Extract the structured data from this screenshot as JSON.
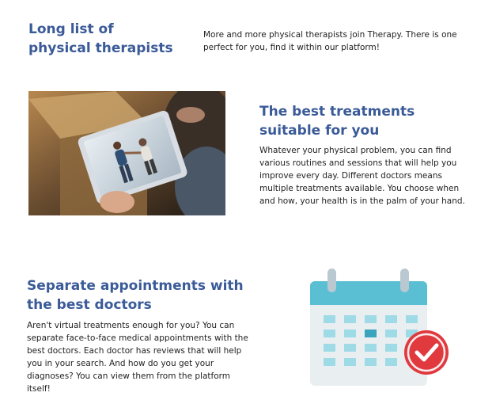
{
  "sections": [
    {
      "title_line1": "Long list of",
      "title_line2": "physical therapists",
      "text": "More and more physical therapists join Therapy. There is one perfect for you, find it within our platform!"
    },
    {
      "title": "The best treatments suitable for you",
      "text": "Whatever your physical problem, you can find various routines and sessions that will help you improve every day. Different doctors means multiple treatments available. You choose when and how, your health is in the palm of your hand.",
      "image": "tablet-video-therapy-photo"
    },
    {
      "title": "Separate appointments with the best doctors",
      "text": "Aren't virtual treatments enough for you? You can separate face-to-face medical appointments with the best doctors. Each doctor has reviews that will help you in your search. And how do you get your diagnoses? You can view them from the platform itself!",
      "icon": "calendar-check-icon"
    }
  ],
  "colors": {
    "heading": "#3a5a98",
    "calendar_header": "#5bbfd3",
    "calendar_cells": "#9fdbe6",
    "calendar_selected": "#3aa3bd",
    "check_badge": "#e0393e"
  }
}
